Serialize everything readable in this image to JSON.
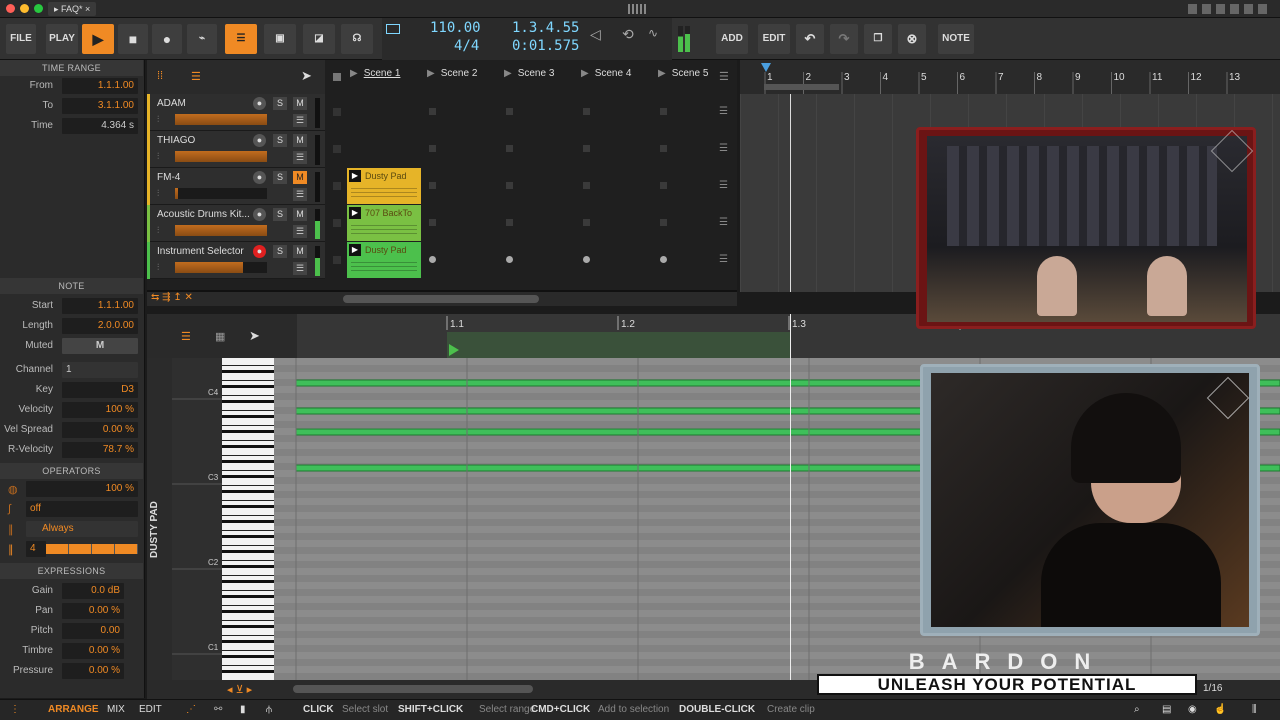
{
  "window": {
    "tab": "FAQ*"
  },
  "toolbar": {
    "file": "FILE",
    "play": "PLAY",
    "add": "ADD",
    "edit": "EDIT",
    "note": "NOTE"
  },
  "transport": {
    "tempo": "110.00",
    "signature": "4/4",
    "position": "1.3.4.55",
    "time": "0:01.575"
  },
  "time_range": {
    "header": "TIME RANGE",
    "from_label": "From",
    "from": "1.1.1.00",
    "to_label": "To",
    "to": "3.1.1.00",
    "time_label": "Time",
    "time": "4.364 s"
  },
  "note": {
    "header": "NOTE",
    "start_label": "Start",
    "start": "1.1.1.00",
    "length_label": "Length",
    "length": "2.0.0.00",
    "muted_label": "Muted",
    "muted": "M",
    "channel_label": "Channel",
    "channel": "1",
    "key_label": "Key",
    "key": "D3",
    "velocity_label": "Velocity",
    "velocity": "100 %",
    "velspread_label": "Vel Spread",
    "velspread": "0.00 %",
    "rvel_label": "R-Velocity",
    "rvel": "78.7 %"
  },
  "operators": {
    "header": "OPERATORS",
    "chance": "100 %",
    "repeat": "off",
    "condition": "Always",
    "recurrence": "4"
  },
  "expressions": {
    "header": "EXPRESSIONS",
    "gain_label": "Gain",
    "gain": "0.0 dB",
    "pan_label": "Pan",
    "pan": "0.00 %",
    "pitch_label": "Pitch",
    "pitch": "0.00",
    "timbre_label": "Timbre",
    "timbre": "0.00 %",
    "pressure_label": "Pressure",
    "pressure": "0.00 %"
  },
  "tracks": [
    {
      "name": "ADAM",
      "color": "#e6b428"
    },
    {
      "name": "THIAGO",
      "color": "#e6b428"
    },
    {
      "name": "FM-4",
      "color": "#e6b428"
    },
    {
      "name": "Acoustic Drums Kit...",
      "color": "#7ac043"
    },
    {
      "name": "Instrument Selector",
      "color": "#4cc04c"
    }
  ],
  "track_buttons": {
    "s": "S",
    "m": "M"
  },
  "scenes": [
    "Scene 1",
    "Scene 2",
    "Scene 3",
    "Scene 4",
    "Scene 5"
  ],
  "clips": [
    {
      "label": "Dusty Pad",
      "color": "#e6b428"
    },
    {
      "label": "707 BackTo",
      "color": "#7ac043"
    },
    {
      "label": "Dusty Pad",
      "color": "#4cc04c"
    }
  ],
  "arranger_ruler": [
    "1",
    "2",
    "3",
    "4",
    "5",
    "6",
    "7",
    "8",
    "9",
    "10",
    "11",
    "12",
    "13"
  ],
  "piano_roll": {
    "ruler": [
      "1.1",
      "1.2",
      "1.3",
      "1.4"
    ],
    "clip_name": "DUSTY PAD",
    "octaves": [
      "C4",
      "C3",
      "C2",
      "C1"
    ],
    "grid": "1/16"
  },
  "overlay": {
    "brand": "BARDON",
    "tagline": "UNLEASH YOUR POTENTIAL"
  },
  "bottom": {
    "arrange": "ARRANGE",
    "mix": "MIX",
    "edit": "EDIT",
    "hints": [
      {
        "key": "CLICK",
        "desc": "Select slot"
      },
      {
        "key": "SHIFT+CLICK",
        "desc": "Select range"
      },
      {
        "key": "CMD+CLICK",
        "desc": "Add to selection"
      },
      {
        "key": "DOUBLE-CLICK",
        "desc": "Create clip"
      }
    ]
  }
}
